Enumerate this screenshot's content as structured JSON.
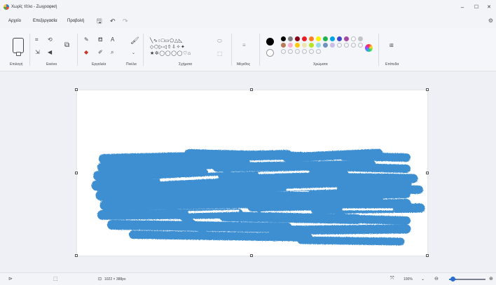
{
  "window": {
    "title": "Χωρίς τίτλο - Ζωγραφική",
    "minimize_glyph": "–",
    "maximize_glyph": "☐",
    "close_glyph": "✕"
  },
  "menu": {
    "file": "Αρχείο",
    "edit": "Επεξεργασία",
    "view": "Προβολή",
    "save_icon": "save-icon",
    "undo_icon": "undo-icon",
    "redo_icon": "redo-icon",
    "settings_icon": "gear-icon"
  },
  "ribbon": {
    "groups": {
      "selection": "Επιλογή",
      "image": "Εικόνα",
      "tools": "Εργαλεία",
      "brushes": "Πινέλα",
      "shapes": "Σχήματα",
      "size": "Μέγεθος",
      "colors": "Χρώματα",
      "layers": "Επίπεδα"
    },
    "shapes_rows": [
      "╲∿○□▭⬠△◺",
      "◇⬡▷◁⇧⇩✧✦",
      "★✲◯◯◯◯♡⌂"
    ],
    "primary_color": "#000000",
    "secondary_color": "#ffffff",
    "palette": [
      "#000000",
      "#7f7f7f",
      "#880015",
      "#ed1c24",
      "#ff7f27",
      "#fff200",
      "#22b14c",
      "#00a2e8",
      "#3f48cc",
      "#a349a4",
      "#ffffff",
      "#c3c3c3",
      "#b97a57",
      "#ffaec9",
      "#ffc90e",
      "#efe4b0",
      "#b5e61d",
      "#99d9ea",
      "#7092be",
      "#c8bfe7"
    ],
    "empty_swatches": 10
  },
  "canvas": {
    "background": "#ffffff",
    "scribble_color": "#3d8fd1"
  },
  "status": {
    "canvas_size": "1022 × 388px",
    "zoom": "100%"
  }
}
